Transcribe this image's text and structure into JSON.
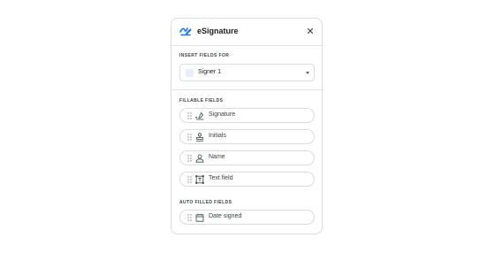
{
  "panel": {
    "title": "eSignature",
    "logo_icon": "signature-pen-icon",
    "close_icon": "close-icon"
  },
  "insert_fields": {
    "label": "INSERT FIELDS FOR",
    "selected_signer": "Signer 1",
    "signer_color": "#e8eefc",
    "dropdown_icon": "caret-down-icon"
  },
  "fillable_fields": {
    "label": "FILLABLE FIELDS",
    "items": [
      {
        "label": "Signature",
        "icon": "signature-icon"
      },
      {
        "label": "Initials",
        "icon": "initials-stamp-icon"
      },
      {
        "label": "Name",
        "icon": "person-icon"
      },
      {
        "label": "Text field",
        "icon": "text-field-icon"
      }
    ]
  },
  "auto_filled_fields": {
    "label": "AUTO FILLED FIELDS",
    "items": [
      {
        "label": "Date signed",
        "icon": "calendar-icon"
      }
    ]
  },
  "colors": {
    "accent": "#1a73e8",
    "border": "#dadce0",
    "text": "#202124"
  }
}
